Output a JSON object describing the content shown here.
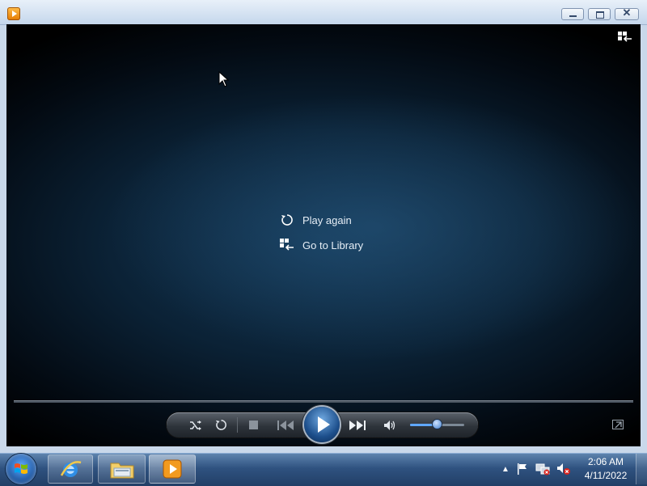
{
  "window": {
    "icon": "media-player-icon",
    "controls": [
      "minimize",
      "maximize",
      "close"
    ]
  },
  "overlay": {
    "play_again_label": "Play again",
    "go_to_library_label": "Go to Library"
  },
  "player": {
    "progress": 0,
    "volume": 0.5,
    "buttons": [
      "shuffle",
      "repeat",
      "stop",
      "previous",
      "play",
      "next",
      "mute"
    ]
  },
  "taskbar": {
    "apps": [
      "internet-explorer",
      "windows-explorer",
      "windows-media-player"
    ],
    "clock_time": "2:06 AM",
    "clock_date": "4/11/2022"
  },
  "colors": {
    "accent": "#1d4f8c",
    "taskbar": "#2f5280"
  }
}
